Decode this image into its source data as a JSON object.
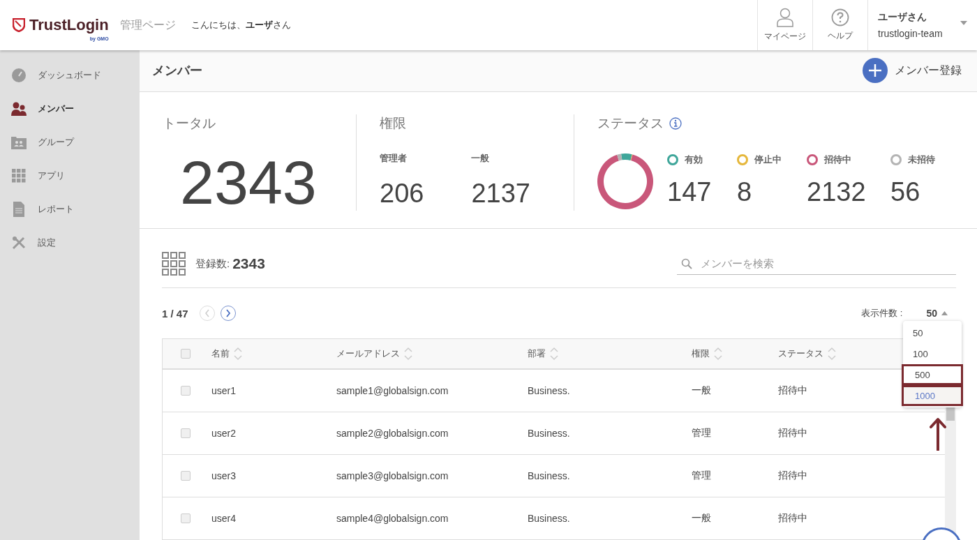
{
  "header": {
    "logo": "TrustLogin",
    "logo_sub": "by GMO",
    "section": "管理ページ",
    "greeting": "こんにちは、**ユーザ**さん",
    "nav": [
      {
        "label": "マイページ",
        "kind": "person"
      },
      {
        "label": "ヘルプ",
        "kind": "help"
      }
    ],
    "account": {
      "name": "ユーザさん",
      "team": "trustlogin-team"
    }
  },
  "sidebar": {
    "items": [
      {
        "label": "ダッシュボード",
        "kind": "gauge",
        "selected": false
      },
      {
        "label": "メンバー",
        "kind": "people",
        "selected": true
      },
      {
        "label": "グループ",
        "kind": "group",
        "selected": false
      },
      {
        "label": "アプリ",
        "kind": "apps",
        "selected": false
      },
      {
        "label": "レポート",
        "kind": "report",
        "selected": false
      },
      {
        "label": "設定",
        "kind": "tools",
        "selected": false
      }
    ]
  },
  "page": {
    "title": "メンバー",
    "add_button": "メンバー登録"
  },
  "stats": {
    "total": {
      "label": "トータル",
      "value": "2343"
    },
    "roles": {
      "label": "権限",
      "items": [
        {
          "label": "管理者",
          "value": "206"
        },
        {
          "label": "一般",
          "value": "2137"
        }
      ]
    },
    "status": {
      "label": "ステータス",
      "items": [
        {
          "label": "有効",
          "value": "147",
          "color": "#3fa69a"
        },
        {
          "label": "停止中",
          "value": "8",
          "color": "#e5b73b"
        },
        {
          "label": "招待中",
          "value": "2132",
          "color": "#c9577a"
        },
        {
          "label": "未招待",
          "value": "56",
          "color": "#b4b4b4"
        }
      ]
    }
  },
  "list": {
    "count_label": "登録数:",
    "count": "2343",
    "search": {
      "placeholder": "メンバーを検索"
    },
    "page": "1 / 47",
    "per_page_label": "表示件数 :",
    "per_page": "50",
    "per_page_options": [
      {
        "label": "50",
        "highlighted": false,
        "outlined": false
      },
      {
        "label": "100",
        "highlighted": false,
        "outlined": false
      },
      {
        "label": "500",
        "highlighted": false,
        "outlined": true
      },
      {
        "label": "1000",
        "highlighted": true,
        "outlined": true
      }
    ]
  },
  "table": {
    "select_all_checked": false,
    "columns": [
      "名前",
      "メールアドレス",
      "部署",
      "権限",
      "ステータス"
    ],
    "rows": [
      {
        "checked": false,
        "cells": [
          "user1",
          "sample1@globalsign.com",
          "Business.",
          "一般",
          "招待中"
        ]
      },
      {
        "checked": false,
        "cells": [
          "user2",
          "sample2@globalsign.com",
          "Business.",
          "管理",
          "招待中"
        ]
      },
      {
        "checked": false,
        "cells": [
          "user3",
          "sample3@globalsign.com",
          "Business.",
          "管理",
          "招待中"
        ]
      },
      {
        "checked": false,
        "cells": [
          "user4",
          "sample4@globalsign.com",
          "Business.",
          "一般",
          "招待中"
        ]
      }
    ]
  }
}
